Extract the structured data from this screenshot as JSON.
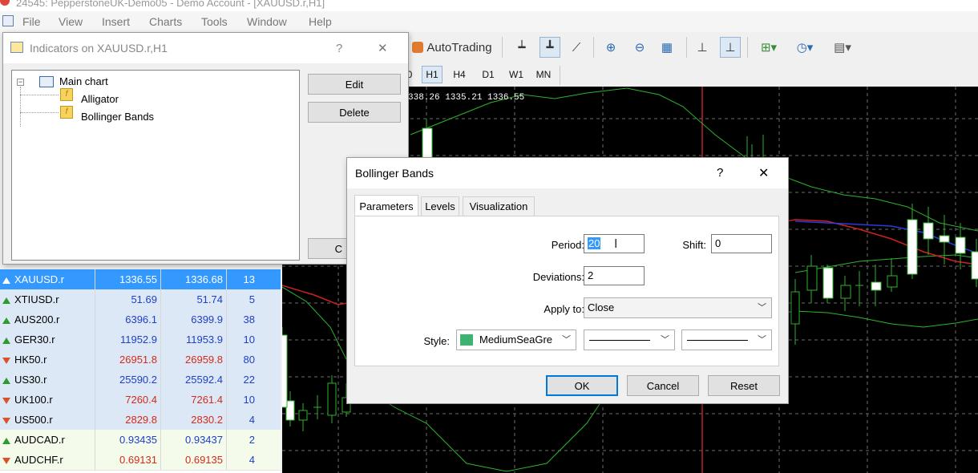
{
  "window": {
    "title": "24545: PepperstoneUK-Demo05 - Demo Account - [XAUUSD.r,H1]"
  },
  "menu": [
    "File",
    "View",
    "Insert",
    "Charts",
    "Tools",
    "Window",
    "Help"
  ],
  "toolbar": {
    "autotrading_label": "AutoTrading"
  },
  "timeframes": [
    "0",
    "H1",
    "H4",
    "D1",
    "W1",
    "MN"
  ],
  "chart": {
    "ohlc_text": "338.26 1335.21 1336.55"
  },
  "indicators_dialog": {
    "title": "Indicators on XAUUSD.r,H1",
    "help": "?",
    "close": "✕",
    "tree_root": "Main chart",
    "items": [
      "Alligator",
      "Bollinger Bands"
    ],
    "edit_label": "Edit",
    "delete_label": "Delete",
    "close_btn_partial": "C"
  },
  "market_watch": {
    "rows": [
      {
        "symbol": "XAUUSD.r",
        "bid": "1336.55",
        "ask": "1336.68",
        "spread": "13",
        "dir": "up",
        "selected": true
      },
      {
        "symbol": "XTIUSD.r",
        "bid": "51.69",
        "ask": "51.74",
        "spread": "5",
        "dir": "up",
        "color": "#1f3fc4"
      },
      {
        "symbol": "AUS200.r",
        "bid": "6396.1",
        "ask": "6399.9",
        "spread": "38",
        "dir": "up",
        "color": "#1f3fc4"
      },
      {
        "symbol": "GER30.r",
        "bid": "11952.9",
        "ask": "11953.9",
        "spread": "10",
        "dir": "up",
        "color": "#1f3fc4"
      },
      {
        "symbol": "HK50.r",
        "bid": "26951.8",
        "ask": "26959.8",
        "spread": "80",
        "dir": "down",
        "color": "#d42a1a"
      },
      {
        "symbol": "US30.r",
        "bid": "25590.2",
        "ask": "25592.4",
        "spread": "22",
        "dir": "up",
        "color": "#1f3fc4"
      },
      {
        "symbol": "UK100.r",
        "bid": "7260.4",
        "ask": "7261.4",
        "spread": "10",
        "dir": "down",
        "color": "#d42a1a"
      },
      {
        "symbol": "US500.r",
        "bid": "2829.8",
        "ask": "2830.2",
        "spread": "4",
        "dir": "down",
        "color": "#d42a1a"
      },
      {
        "symbol": "AUDCAD.r",
        "bid": "0.93435",
        "ask": "0.93437",
        "spread": "2",
        "dir": "up",
        "color": "#1f3fc4"
      },
      {
        "symbol": "AUDCHF.r",
        "bid": "0.69131",
        "ask": "0.69135",
        "spread": "4",
        "dir": "down",
        "color": "#d42a1a"
      }
    ]
  },
  "bb_dialog": {
    "title": "Bollinger Bands",
    "help": "?",
    "close": "✕",
    "tabs": [
      "Parameters",
      "Levels",
      "Visualization"
    ],
    "period_label": "Period:",
    "period_value": "20",
    "shift_label": "Shift:",
    "shift_value": "0",
    "deviations_label": "Deviations:",
    "deviations_value": "2",
    "apply_label": "Apply to:",
    "apply_value": "Close",
    "style_label": "Style:",
    "style_color_name": "MediumSeaGre",
    "style_color": "#3cb371",
    "ok_label": "OK",
    "cancel_label": "Cancel",
    "reset_label": "Reset"
  }
}
